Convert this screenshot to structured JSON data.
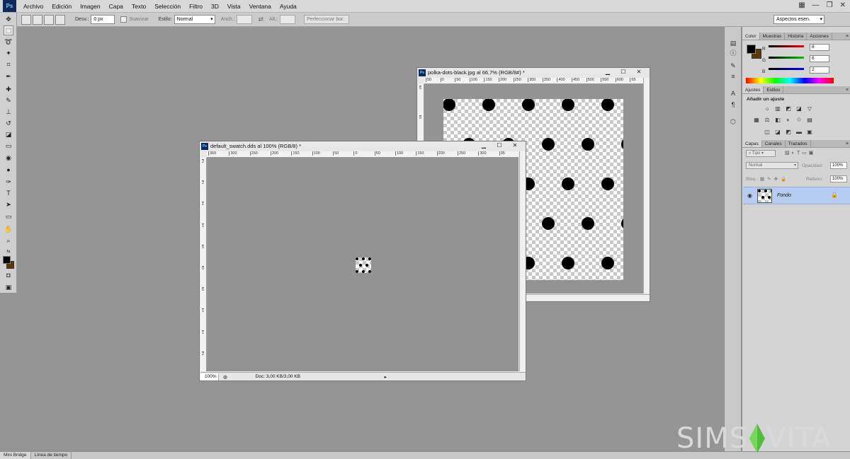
{
  "app": {
    "logo": "Ps"
  },
  "menu": [
    "Archivo",
    "Edición",
    "Imagen",
    "Capa",
    "Texto",
    "Selección",
    "Filtro",
    "3D",
    "Vista",
    "Ventana",
    "Ayuda"
  ],
  "options": {
    "feather_label": "Desv.:",
    "feather_value": "0 px",
    "antialias_label": "Suavizar",
    "style_label": "Estilo:",
    "style_value": "Normal",
    "width_label": "Anch.:",
    "height_label": "Alt.:",
    "refine_label": "Perfeccionar bor.",
    "workspace": "Aspectos esen."
  },
  "color_panel": {
    "tabs": [
      "Color",
      "Muestras",
      "Historia",
      "Acciones"
    ],
    "r_label": "R",
    "g_label": "G",
    "b_label": "B",
    "r": "8",
    "g": "6",
    "b": "2"
  },
  "adjust_panel": {
    "tabs": [
      "Ajustes",
      "Estilos"
    ],
    "title": "Añadir un ajuste"
  },
  "layers_panel": {
    "tabs": [
      "Capas",
      "Canales",
      "Trazados"
    ],
    "kind": "Tipo",
    "blend": "Normal",
    "opacity_label": "Opacidad:",
    "opacity": "100%",
    "lock_label": "Bloq.:",
    "fill_label": "Relleno:",
    "fill": "100%",
    "layer_name": "Fondo"
  },
  "doc1": {
    "title": "polka-dots-black.jpg al 66,7% (RGB/8#) *",
    "ruler_h": [
      "50",
      "0",
      "50",
      "100",
      "150",
      "200",
      "250",
      "300",
      "350",
      "400",
      "450",
      "500",
      "550",
      "600",
      "65"
    ],
    "ruler_v": [
      "5",
      "0",
      "5",
      "1",
      "1",
      "2",
      "2"
    ]
  },
  "doc2": {
    "title": "default_swatch.dds al 100% (RGB/8) *",
    "ruler_h": [
      "350",
      "300",
      "250",
      "200",
      "150",
      "100",
      "50",
      "0",
      "50",
      "100",
      "150",
      "200",
      "250",
      "300",
      "35"
    ],
    "ruler_v": [
      "2",
      "2",
      "1",
      "1",
      "5",
      "0",
      "5",
      "1",
      "1",
      "2"
    ],
    "zoom": "100%",
    "doc_info": "Doc: 3,00 KB/3,00 KB"
  },
  "bottom_tabs": [
    "Mini Bridge",
    "Línea de tiempo"
  ],
  "watermark": {
    "left": "SIMS",
    "right": "VITA"
  },
  "colors": {
    "foreground": "#000000",
    "background": "#5a3a0c"
  }
}
